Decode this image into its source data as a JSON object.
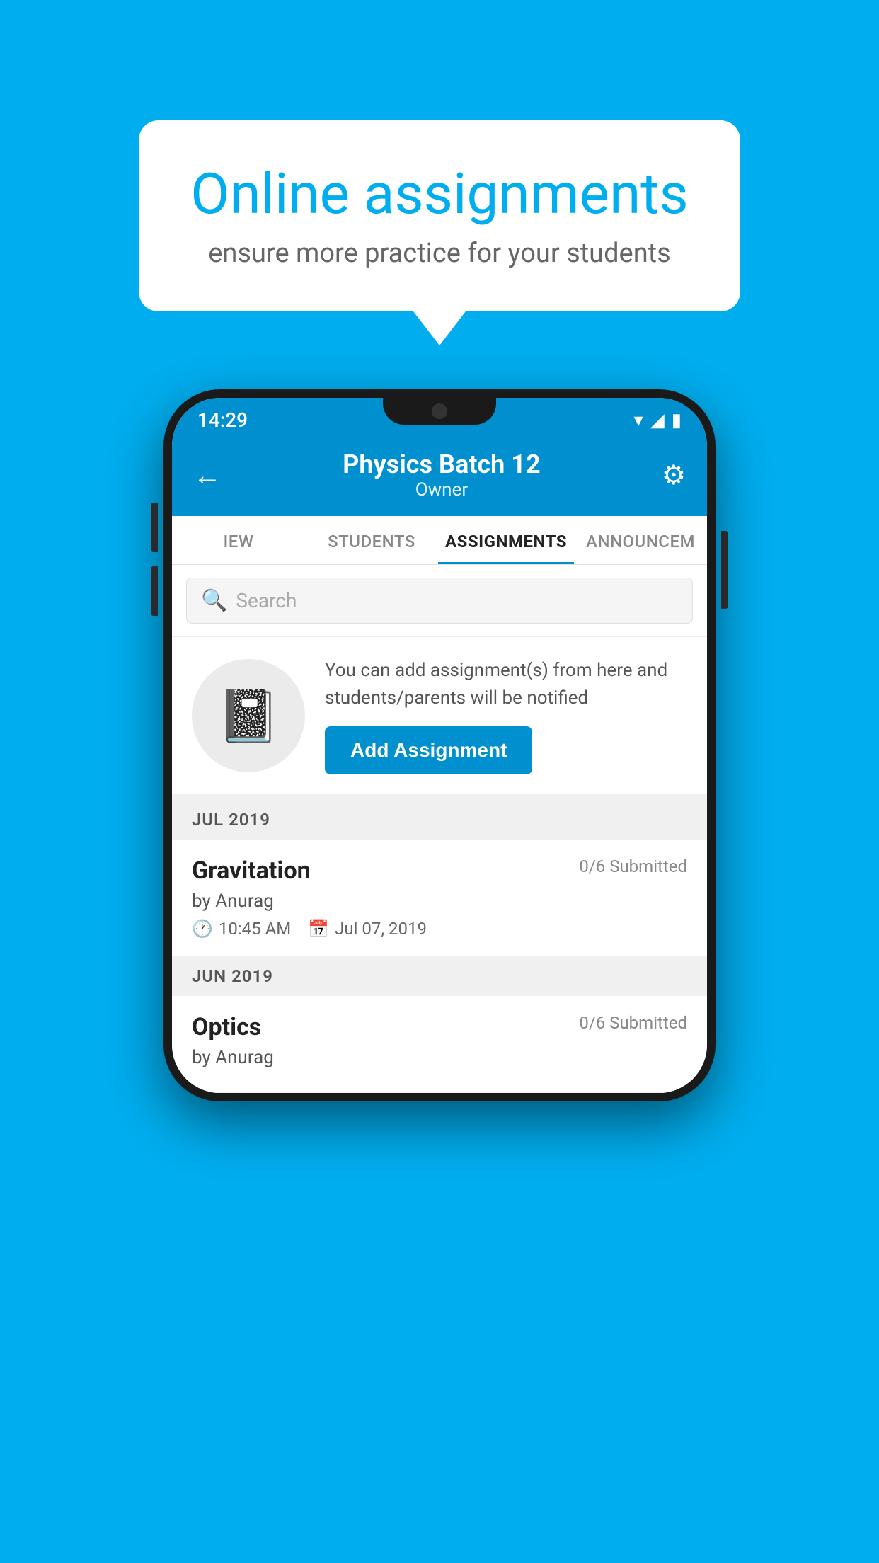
{
  "background_color": "#00AEEF",
  "speech_bubble": {
    "title": "Online assignments",
    "subtitle": "ensure more practice for your students"
  },
  "phone": {
    "status_bar": {
      "time": "14:29",
      "icons": [
        "wifi",
        "signal",
        "battery"
      ]
    },
    "header": {
      "title": "Physics Batch 12",
      "subtitle": "Owner",
      "back_label": "←",
      "gear_label": "⚙"
    },
    "tabs": [
      {
        "label": "IEW",
        "active": false
      },
      {
        "label": "STUDENTS",
        "active": false
      },
      {
        "label": "ASSIGNMENTS",
        "active": true
      },
      {
        "label": "ANNOUNCEM",
        "active": false
      }
    ],
    "search": {
      "placeholder": "Search"
    },
    "add_assignment": {
      "description": "You can add assignment(s) from here and students/parents will be notified",
      "button_label": "Add Assignment"
    },
    "sections": [
      {
        "month": "JUL 2019",
        "assignments": [
          {
            "name": "Gravitation",
            "submitted": "0/6 Submitted",
            "by": "by Anurag",
            "time": "10:45 AM",
            "date": "Jul 07, 2019"
          }
        ]
      },
      {
        "month": "JUN 2019",
        "assignments": [
          {
            "name": "Optics",
            "submitted": "0/6 Submitted",
            "by": "by Anurag",
            "time": "",
            "date": ""
          }
        ]
      }
    ]
  }
}
